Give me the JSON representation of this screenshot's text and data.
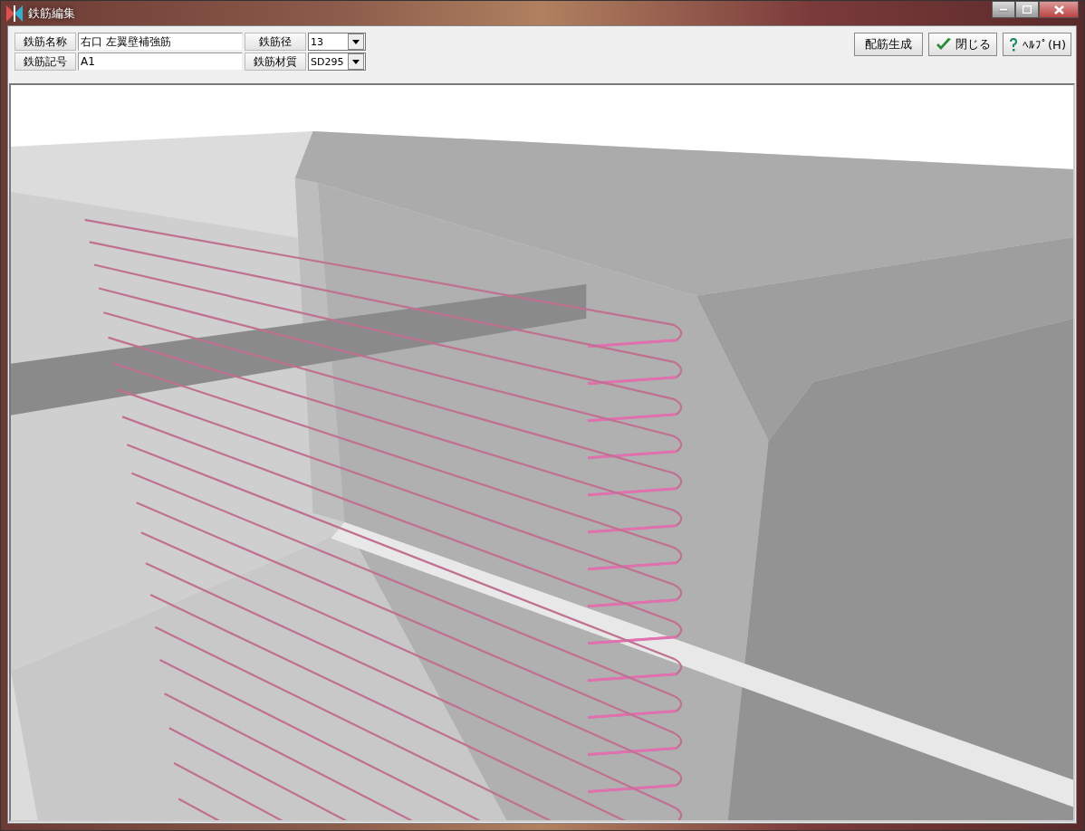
{
  "window": {
    "title": "鉄筋編集"
  },
  "fields": [
    {
      "label": "鉄筋名称",
      "value": "右口 左翼壁補強筋",
      "kind": "text"
    },
    {
      "label": "鉄筋径",
      "value": "13",
      "kind": "select"
    },
    {
      "label": "鉄筋記号",
      "value": "A1",
      "kind": "text"
    },
    {
      "label": "鉄筋材質",
      "value": "SD295",
      "kind": "select"
    }
  ],
  "buttons": [
    {
      "label": "配筋生成",
      "kind": "plain"
    },
    {
      "label": "閉じる",
      "kind": "check"
    },
    {
      "label": "ﾍﾙﾌﾟ(H)",
      "kind": "help"
    }
  ]
}
